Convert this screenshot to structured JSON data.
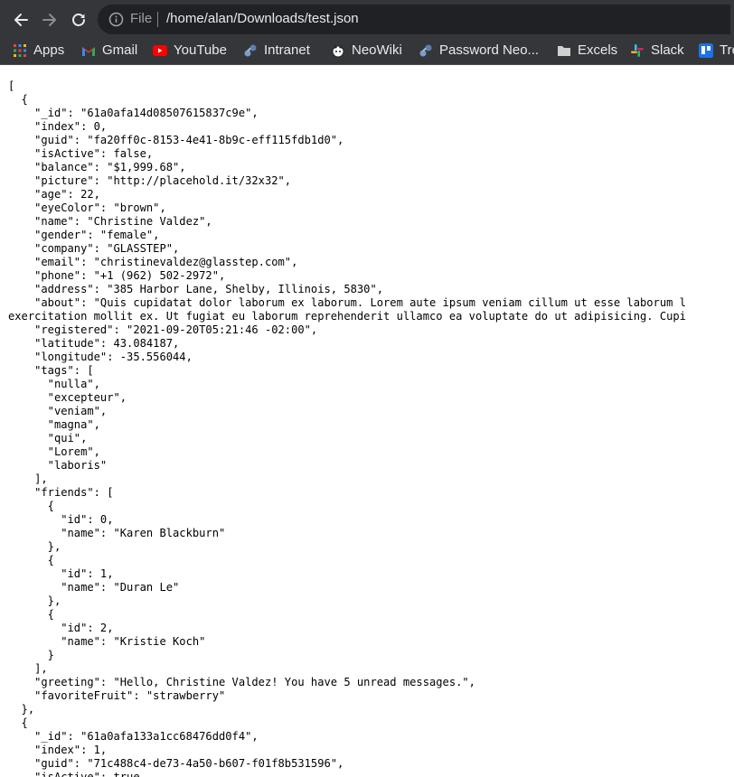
{
  "toolbar": {
    "scheme_label": "File",
    "url": "/home/alan/Downloads/test.json"
  },
  "bookmarks": [
    {
      "label": "Apps",
      "icon": "apps-grid-icon"
    },
    {
      "label": "Gmail",
      "icon": "gmail-icon"
    },
    {
      "label": "YouTube",
      "icon": "youtube-icon"
    },
    {
      "label": "Intranet",
      "icon": "puzzle-icon"
    },
    {
      "label": "NeoWiki",
      "icon": "mascot-icon"
    },
    {
      "label": "Password Neo...",
      "icon": "puzzle-icon"
    },
    {
      "label": "Excels",
      "icon": "folder-icon"
    },
    {
      "label": "Slack",
      "icon": "slack-icon"
    },
    {
      "label": "Tre",
      "icon": "trello-icon"
    }
  ],
  "json_lines": [
    "[",
    "  {",
    "    \"_id\": \"61a0afa14d08507615837c9e\",",
    "    \"index\": 0,",
    "    \"guid\": \"fa20ff0c-8153-4e41-8b9c-eff115fdb1d0\",",
    "    \"isActive\": false,",
    "    \"balance\": \"$1,999.68\",",
    "    \"picture\": \"http://placehold.it/32x32\",",
    "    \"age\": 22,",
    "    \"eyeColor\": \"brown\",",
    "    \"name\": \"Christine Valdez\",",
    "    \"gender\": \"female\",",
    "    \"company\": \"GLASSTEP\",",
    "    \"email\": \"christinevaldez@glasstep.com\",",
    "    \"phone\": \"+1 (962) 502-2972\",",
    "    \"address\": \"385 Harbor Lane, Shelby, Illinois, 5830\",",
    "    \"about\": \"Quis cupidatat dolor laborum ex laborum. Lorem aute ipsum veniam cillum ut esse laborum l",
    "exercitation mollit ex. Ut fugiat eu laborum reprehenderit ullamco ea voluptate do ut adipisicing. Cupi",
    "    \"registered\": \"2021-09-20T05:21:46 -02:00\",",
    "    \"latitude\": 43.084187,",
    "    \"longitude\": -35.556044,",
    "    \"tags\": [",
    "      \"nulla\",",
    "      \"excepteur\",",
    "      \"veniam\",",
    "      \"magna\",",
    "      \"qui\",",
    "      \"Lorem\",",
    "      \"laboris\"",
    "    ],",
    "    \"friends\": [",
    "      {",
    "        \"id\": 0,",
    "        \"name\": \"Karen Blackburn\"",
    "      },",
    "      {",
    "        \"id\": 1,",
    "        \"name\": \"Duran Le\"",
    "      },",
    "      {",
    "        \"id\": 2,",
    "        \"name\": \"Kristie Koch\"",
    "      }",
    "    ],",
    "    \"greeting\": \"Hello, Christine Valdez! You have 5 unread messages.\",",
    "    \"favoriteFruit\": \"strawberry\"",
    "  },",
    "  {",
    "    \"_id\": \"61a0afa133a1cc68476dd0f4\",",
    "    \"index\": 1,",
    "    \"guid\": \"71c488c4-de73-4a50-b607-f01f8b531596\",",
    "    \"isActive\": true,"
  ]
}
